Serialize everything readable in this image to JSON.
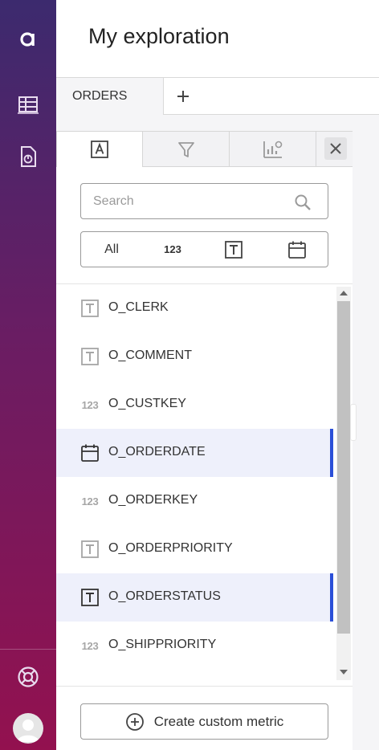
{
  "page": {
    "title": "My exploration"
  },
  "tabs": {
    "active": "ORDERS",
    "add": "+"
  },
  "search": {
    "placeholder": "Search"
  },
  "filters": {
    "all": "All",
    "numeric": "123"
  },
  "fields": [
    {
      "name": "O_CLERK",
      "type": "text",
      "selected": false
    },
    {
      "name": "O_COMMENT",
      "type": "text",
      "selected": false
    },
    {
      "name": "O_CUSTKEY",
      "type": "numeric",
      "selected": false
    },
    {
      "name": "O_ORDERDATE",
      "type": "date",
      "selected": true
    },
    {
      "name": "O_ORDERKEY",
      "type": "numeric",
      "selected": false
    },
    {
      "name": "O_ORDERPRIORITY",
      "type": "text",
      "selected": false
    },
    {
      "name": "O_ORDERSTATUS",
      "type": "text",
      "selected": true
    },
    {
      "name": "O_SHIPPRIORITY",
      "type": "numeric",
      "selected": false
    }
  ],
  "field_type_labels": {
    "numeric": "123"
  },
  "create_metric": {
    "label": "Create custom metric"
  },
  "colors": {
    "accent": "#2b4fd8",
    "selected_row": "#eef0fb",
    "sidebar_top": "#3c2a6e",
    "sidebar_bottom": "#93114f"
  }
}
